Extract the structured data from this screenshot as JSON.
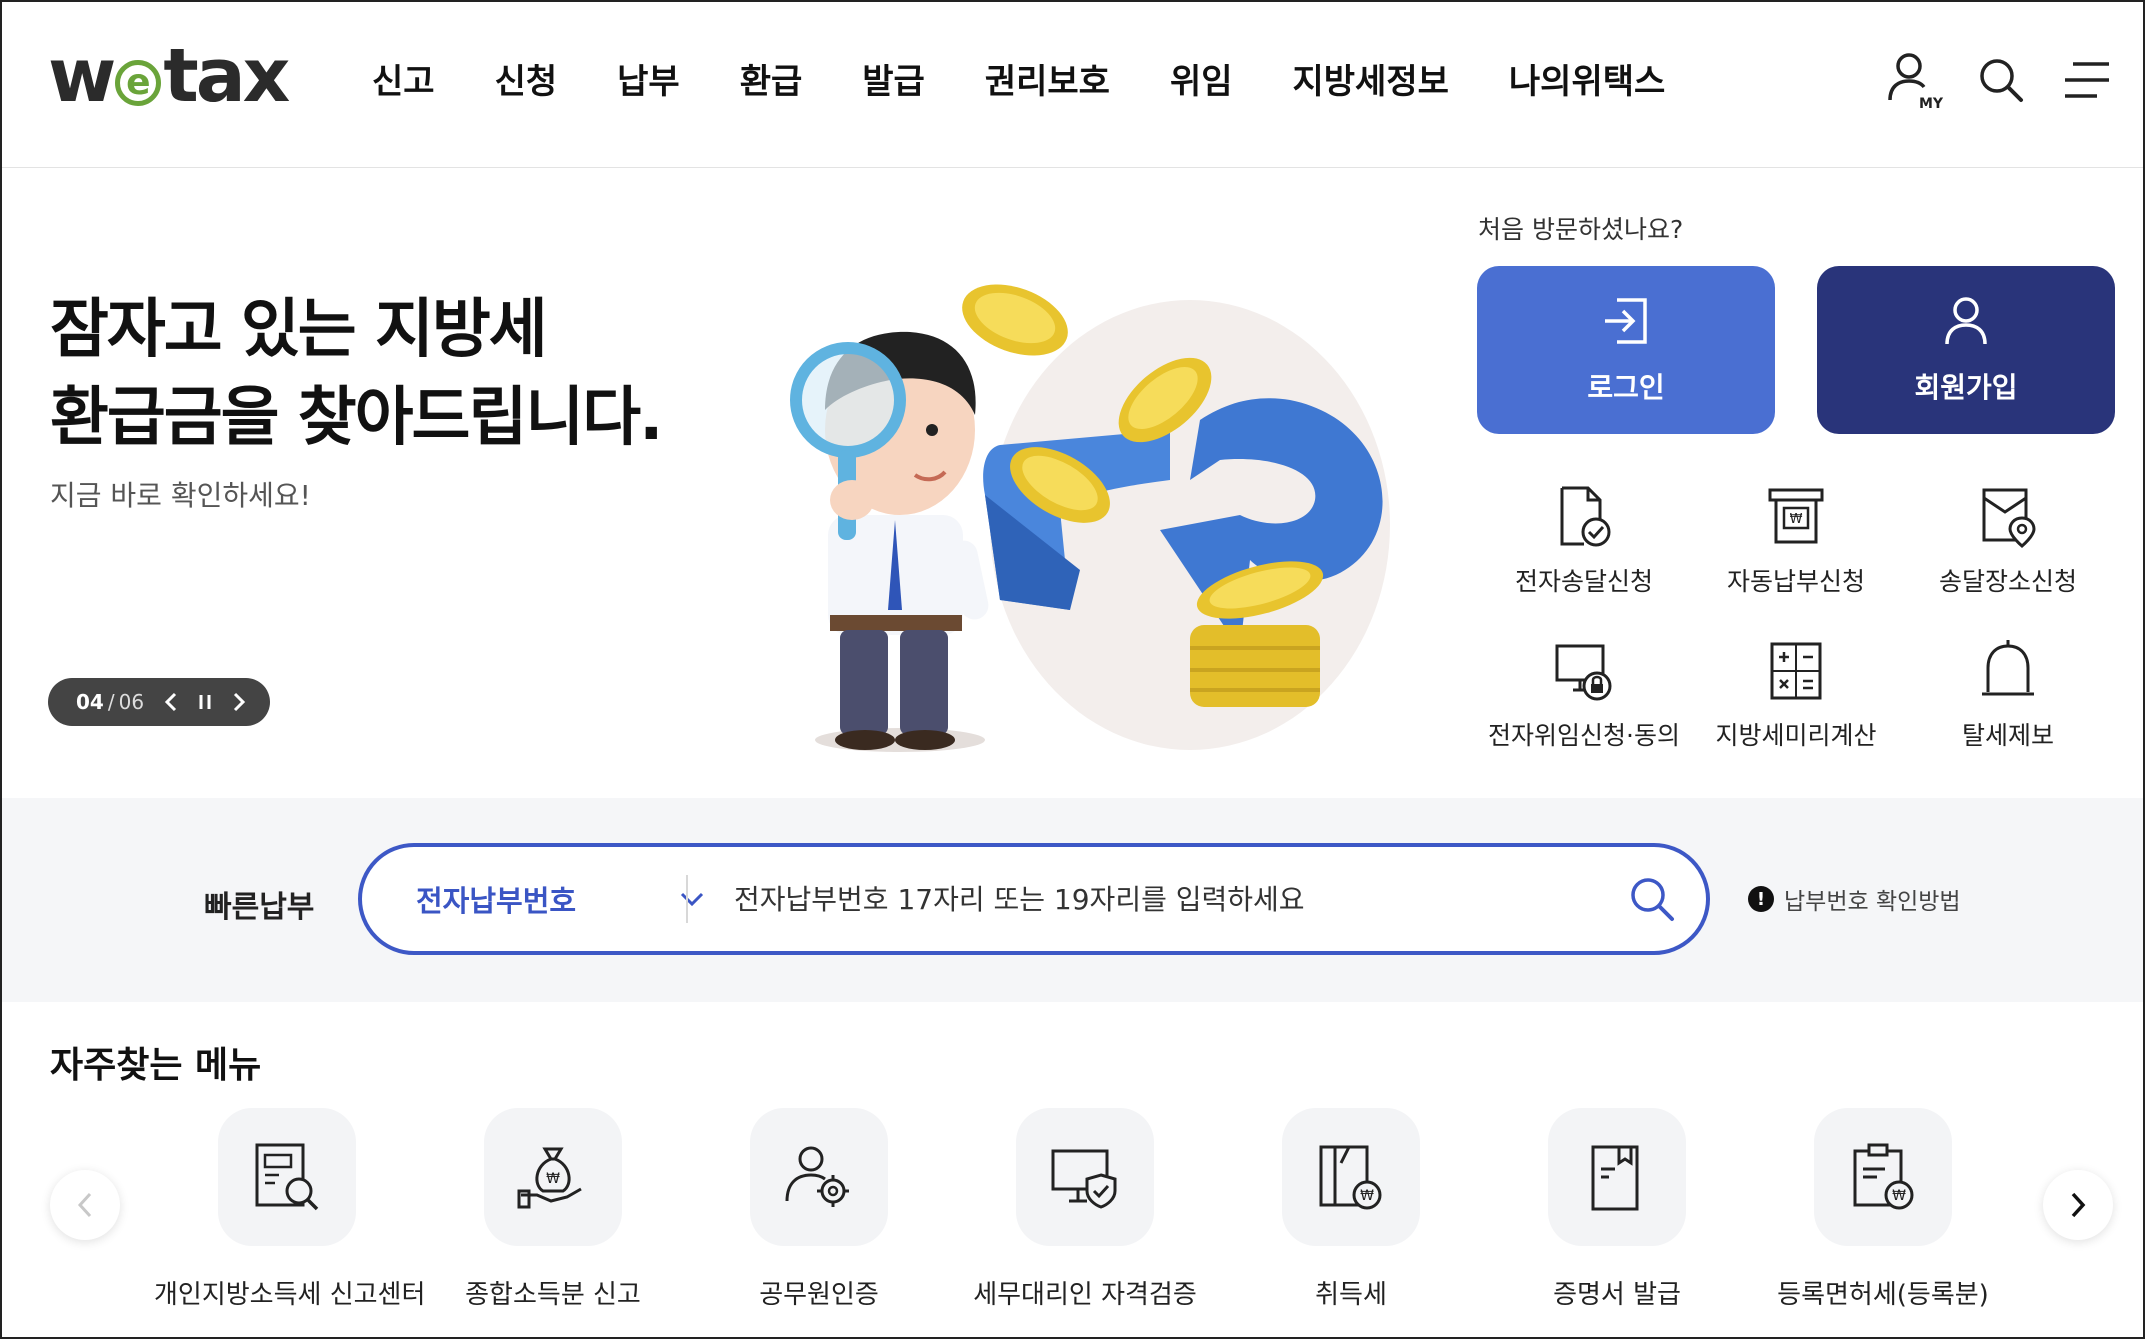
{
  "header": {
    "logo_prefix": "w",
    "logo_e": "e",
    "logo_suffix": "tax",
    "nav": [
      "신고",
      "신청",
      "납부",
      "환급",
      "발급",
      "권리보호",
      "위임",
      "지방세정보",
      "나의위택스"
    ],
    "icons": [
      "my-page-icon",
      "search-icon",
      "menu-icon"
    ],
    "my_badge": "MY"
  },
  "hero": {
    "title_line1": "잠자고 있는 지방세",
    "title_line2": "환급금을 찾아드립니다.",
    "subtitle": "지금 바로 확인하세요!",
    "slide_current": "04",
    "slide_separator": "/",
    "slide_total": "06"
  },
  "account": {
    "first_visit": "처음 방문하셨나요?",
    "login_label": "로그인",
    "join_label": "회원가입"
  },
  "quick_links": [
    {
      "label": "전자송달신청",
      "icon": "document-check-icon"
    },
    {
      "label": "자동납부신청",
      "icon": "auto-pay-icon"
    },
    {
      "label": "송달장소신청",
      "icon": "location-doc-icon"
    },
    {
      "label": "전자위임신청·동의",
      "icon": "monitor-lock-icon"
    },
    {
      "label": "지방세미리계산",
      "icon": "calculator-icon"
    },
    {
      "label": "탈세제보",
      "icon": "bell-icon"
    }
  ],
  "fast_pay": {
    "label": "빠른납부",
    "select_value": "전자납부번호",
    "placeholder": "전자납부번호 17자리 또는 19자리를 입력하세요",
    "howto": "납부번호 확인방법",
    "howto_mark": "!"
  },
  "frequent": {
    "title": "자주찾는 메뉴",
    "items": [
      {
        "label": "개인지방소득세 신고센터",
        "icon": "report-search-icon"
      },
      {
        "label": "종합소득분 신고",
        "icon": "money-bag-hand-icon"
      },
      {
        "label": "공무원인증",
        "icon": "official-gear-icon"
      },
      {
        "label": "세무대리인 자격검증",
        "icon": "monitor-shield-icon"
      },
      {
        "label": "취득세",
        "icon": "building-won-icon"
      },
      {
        "label": "증명서 발급",
        "icon": "certificate-icon"
      },
      {
        "label": "등록면허세(등록분)",
        "icon": "clipboard-won-icon"
      }
    ]
  },
  "colors": {
    "login_blue": "#4a6fd2",
    "join_navy": "#29347a",
    "search_border": "#3d58c6",
    "logo_green": "#6aa43a"
  }
}
